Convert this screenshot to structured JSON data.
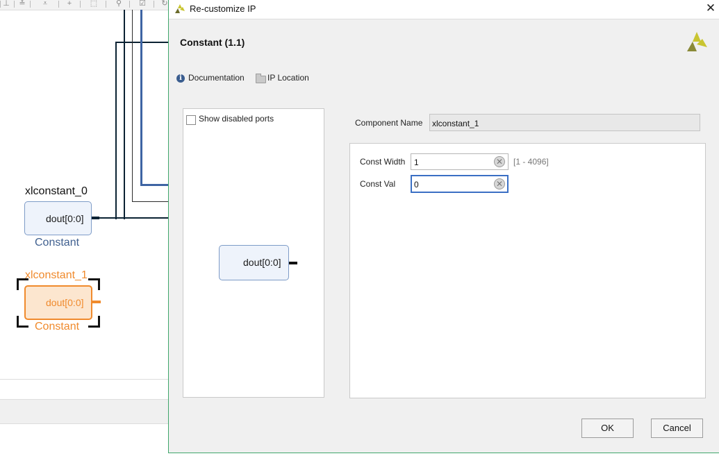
{
  "canvas": {
    "block0": {
      "title": "xlconstant_0",
      "port": "dout[0:0]",
      "subtitle": "Constant"
    },
    "block1": {
      "title": "xlconstant_1",
      "port": "dout[0:0]",
      "subtitle": "Constant"
    }
  },
  "dialog": {
    "title": "Re-customize IP",
    "close_glyph": "✕",
    "heading": "Constant (1.1)",
    "links": {
      "documentation": "Documentation",
      "ip_location": "IP Location"
    },
    "preview": {
      "show_disabled_ports": "Show disabled ports",
      "show_disabled_ports_checked": false,
      "port": "dout[0:0]"
    },
    "component_name": {
      "label": "Component Name",
      "value": "xlconstant_1"
    },
    "params": {
      "const_width": {
        "label": "Const Width",
        "value": "1",
        "range": "[1 - 4096]"
      },
      "const_val": {
        "label": "Const Val",
        "value": "0"
      }
    },
    "buttons": {
      "ok": "OK",
      "cancel": "Cancel"
    }
  },
  "colors": {
    "accent_border": "#3fa66b",
    "block_border": "#7d9bc7",
    "selected_block": "#f08a2c",
    "focus_border": "#3a6fc4"
  }
}
